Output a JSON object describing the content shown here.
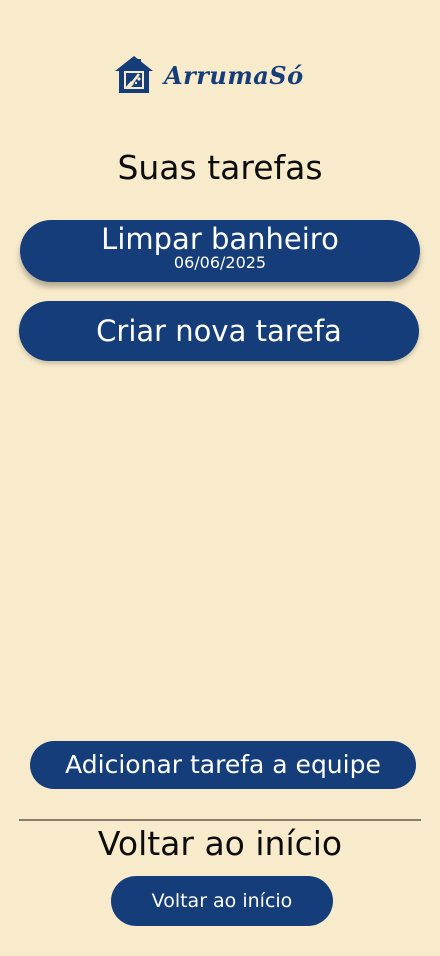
{
  "app": {
    "name": "ArrumaSó",
    "brand_color": "#143d7a",
    "background_color": "#f8ebcc"
  },
  "logo": {
    "icon": "house-broom-icon",
    "text": "ArrumaSó"
  },
  "page": {
    "title": "Suas tarefas"
  },
  "tasks": [
    {
      "title": "Limpar banheiro",
      "date": "06/06/2025"
    }
  ],
  "actions": {
    "new_task_label": "Criar nova tarefa",
    "add_team_task_label": "Adicionar tarefa a equipe"
  },
  "footer": {
    "heading": "Voltar ao início",
    "back_button_label": "Voltar ao início"
  }
}
